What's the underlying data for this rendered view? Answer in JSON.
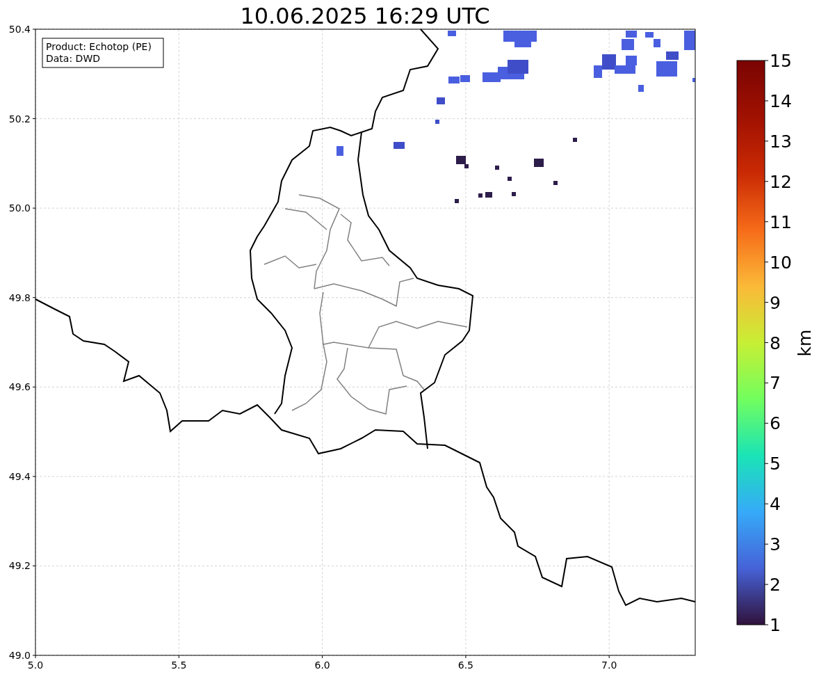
{
  "title": "10.06.2025 16:29 UTC",
  "info_box": [
    "Product: Echotop (PE)",
    "Data: DWD"
  ],
  "x_ticks": [
    "5.0",
    "5.5",
    "6.0",
    "6.5",
    "7.0"
  ],
  "y_ticks": [
    "50.4",
    "50.2",
    "50.0",
    "49.8",
    "49.6",
    "49.4",
    "49.2",
    "49.0"
  ],
  "colorbar": {
    "label": "km",
    "ticks": [
      "15",
      "14",
      "13",
      "12",
      "11",
      "10",
      "9",
      "8",
      "7",
      "6",
      "5",
      "4",
      "3",
      "2",
      "1"
    ]
  }
}
